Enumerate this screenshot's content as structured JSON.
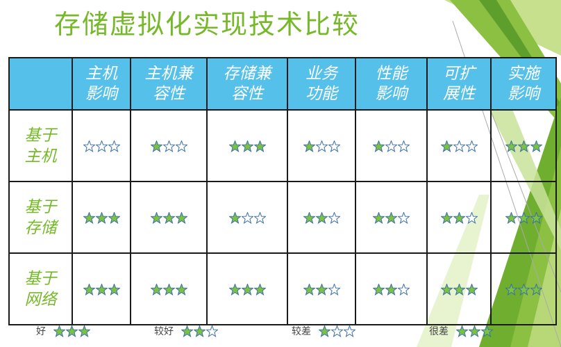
{
  "title": "存储虚拟化实现技术比较",
  "table": {
    "corner": "",
    "headers": [
      "主机影响",
      "主机兼容性",
      "存储兼容性",
      "业务功能",
      "性能影响",
      "可扩展性",
      "实施影响"
    ],
    "rows": [
      {
        "label": "基于主机",
        "ratings": [
          0,
          1,
          3,
          1,
          1,
          1,
          3
        ]
      },
      {
        "label": "基于存储",
        "ratings": [
          3,
          3,
          1,
          2,
          2,
          2,
          3
        ]
      },
      {
        "label": "基于网络",
        "ratings": [
          3,
          3,
          3,
          2,
          2,
          3,
          3
        ]
      }
    ]
  },
  "legend": [
    {
      "label": "好",
      "stars": 3
    },
    {
      "label": "较好",
      "stars": 2
    },
    {
      "label": "较差",
      "stars": 1
    },
    {
      "label": "很差",
      "stars": 3
    }
  ],
  "colors": {
    "accent": "#76b82a",
    "header_fill": "#55c0ea",
    "star_filled": "#7cc242",
    "star_outline": "#3a6fa8"
  }
}
